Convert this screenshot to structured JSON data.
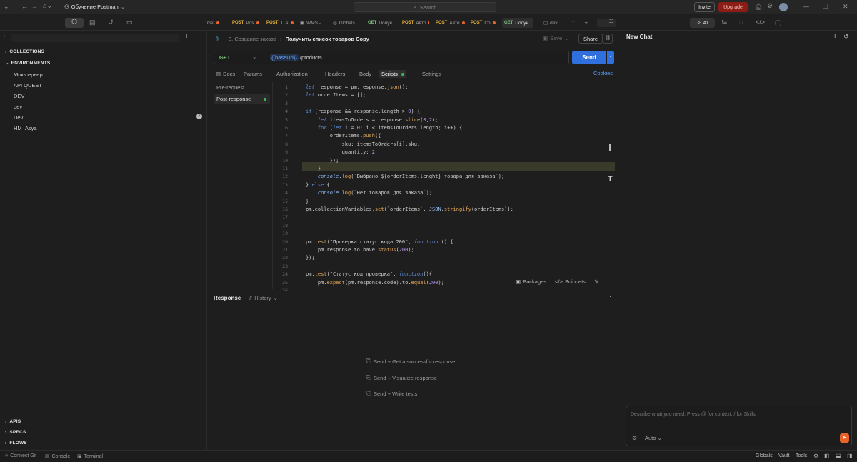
{
  "topbar": {
    "workspace": "Обучение Postman",
    "search_placeholder": "Search",
    "invite": "Invite",
    "upgrade": "Upgrade"
  },
  "tabs": [
    {
      "method": "",
      "label": "Get",
      "dot": true
    },
    {
      "method": "POST",
      "label": "Pos",
      "dot": true
    },
    {
      "method": "POST",
      "label": "1. A",
      "dot": true
    },
    {
      "method": "",
      "label": "WMS -",
      "dot": false
    },
    {
      "method": "",
      "label": "Globals",
      "dot": false
    },
    {
      "method": "GET",
      "label": "Получ",
      "dot": false
    },
    {
      "method": "POST",
      "label": "Авто",
      "dot": true
    },
    {
      "method": "POST",
      "label": "Авто",
      "dot": true
    },
    {
      "method": "POST",
      "label": "Co",
      "dot": true
    },
    {
      "method": "GET",
      "label": "Получ",
      "dot": false
    },
    {
      "method": "",
      "label": "dev",
      "dot": false
    }
  ],
  "sidebar": {
    "collections": "COLLECTIONS",
    "environments": "ENVIRONMENTS",
    "env_items": [
      "Мок-сервер",
      "API QUEST",
      "DEV",
      "dev",
      "Dev",
      "HM_Asya"
    ],
    "apis": "APIS",
    "specs": "SPECS",
    "flows": "FLOWS"
  },
  "request": {
    "breadcrumb_parent": "3. Создание заказа",
    "breadcrumb_sep": "›",
    "title": "Получить список товаров Copy",
    "save": "Save",
    "share": "Share",
    "method": "GET",
    "url_var": "{{baseUrl}}",
    "url_path": "/products",
    "send": "Send",
    "cookies": "Cookies"
  },
  "req_tabs": {
    "docs": "Docs",
    "params": "Params",
    "authorization": "Authorization",
    "headers": "Headers",
    "body": "Body",
    "scripts": "Scripts",
    "settings": "Settings"
  },
  "scripts": {
    "pre": "Pre-request",
    "post": "Post-response",
    "packages": "Packages",
    "snippets": "Snippets"
  },
  "code_lines": [
    "1",
    "2",
    "3",
    "4",
    "5",
    "6",
    "7",
    "8",
    "9",
    "10",
    "11",
    "12",
    "13",
    "14",
    "15",
    "16",
    "17",
    "18",
    "19",
    "20",
    "21",
    "22",
    "23",
    "24",
    "25",
    "26"
  ],
  "response": {
    "label": "Response",
    "history": "History",
    "hint1": "Send + Get a successful response",
    "hint2": "Send + Visualize response",
    "hint3": "Send + Write tests"
  },
  "chat": {
    "ai": "AI",
    "title": "New Chat",
    "placeholder": "Describe what you need. Press @ for context, / for Skills.",
    "auto": "Auto"
  },
  "status": {
    "connect_git": "Connect Git",
    "console": "Console",
    "terminal": "Terminal",
    "globals": "Globals",
    "vault": "Vault",
    "tools": "Tools"
  },
  "colors": {
    "accent": "#2f6fde",
    "upgrade": "#8b1d14",
    "orange": "#e8632a",
    "green": "#3fb950"
  }
}
